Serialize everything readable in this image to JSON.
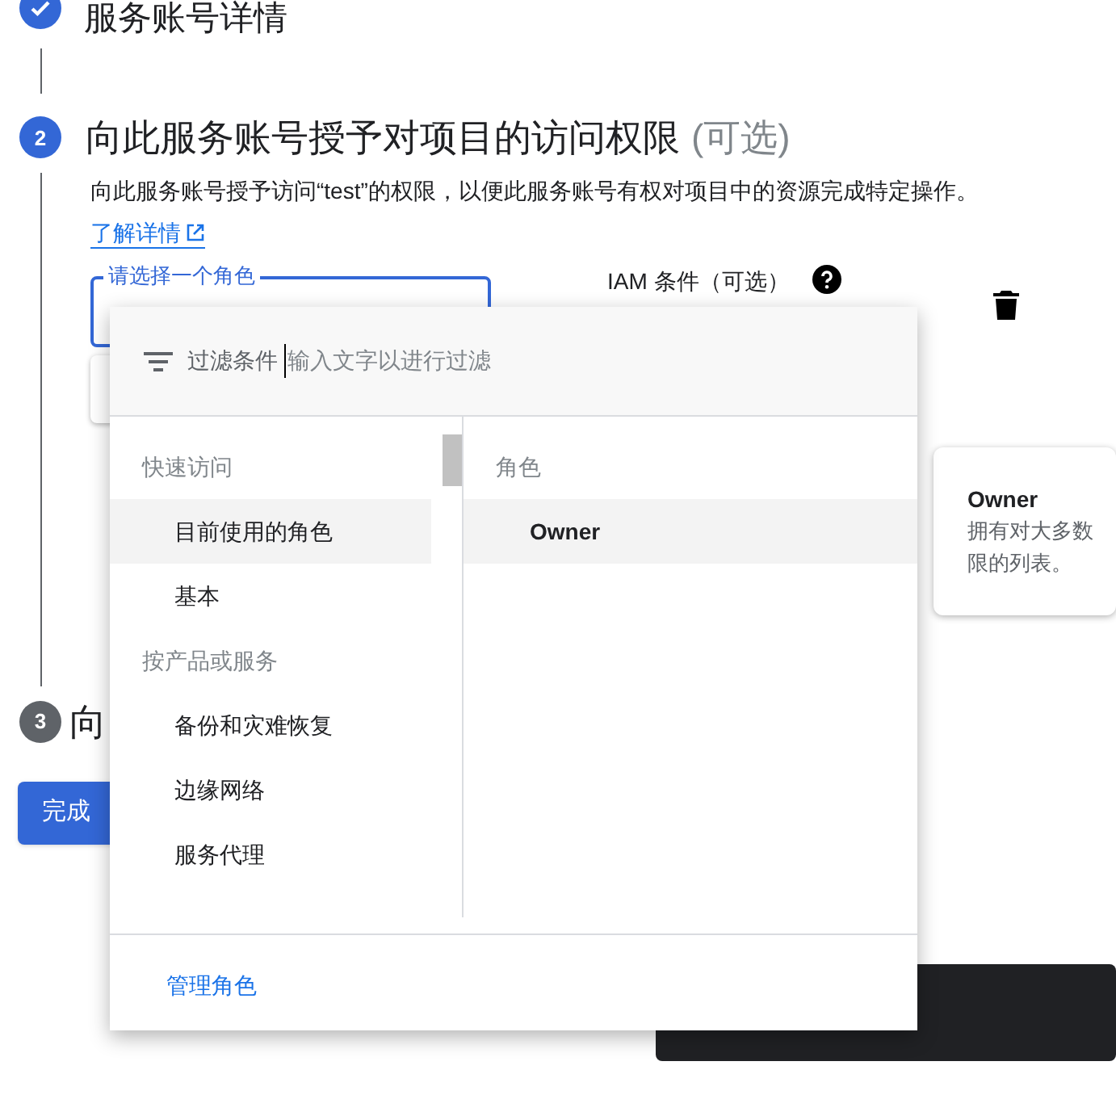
{
  "steps": [
    {
      "kind": "done",
      "title": "服务账号详情"
    },
    {
      "kind": "active",
      "number": "2",
      "title": "向此服务账号授予对项目的访问权限",
      "optional": "(可选)",
      "description": "向此服务账号授予访问“test”的权限，以便此服务账号有权对项目中的资源完成特定操作。",
      "link": "了解详情",
      "role_field": {
        "label": "请选择一个角色"
      },
      "condition_label": "IAM 条件（可选）"
    },
    {
      "kind": "pending",
      "number": "3",
      "title": "向"
    }
  ],
  "done_button": "完成",
  "role_menu": {
    "filter_label": "过滤条件",
    "filter_placeholder": "输入文字以进行过滤",
    "left_items": [
      {
        "kind": "header",
        "label": "快速访问"
      },
      {
        "kind": "item",
        "label": "目前使用的角色",
        "selected": true
      },
      {
        "kind": "item",
        "label": "基本",
        "selected": false
      },
      {
        "kind": "header",
        "label": "按产品或服务"
      },
      {
        "kind": "item",
        "label": "备份和灾难恢复",
        "selected": false
      },
      {
        "kind": "item",
        "label": "边缘网络",
        "selected": false
      },
      {
        "kind": "item",
        "label": "服务代理",
        "selected": false
      }
    ],
    "right_header": "角色",
    "right_items": [
      {
        "label": "Owner",
        "selected": true
      }
    ],
    "manage_link": "管理角色"
  },
  "role_tooltip": {
    "title": "Owner",
    "lines": [
      "拥有对大多数",
      "限的列表。"
    ]
  }
}
